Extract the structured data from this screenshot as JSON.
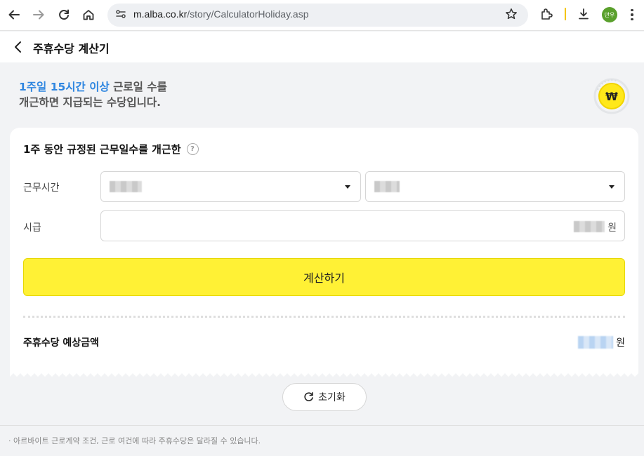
{
  "browser": {
    "url_host": "m.alba.co.kr",
    "url_path": "/story/CalculatorHoliday.asp",
    "profile_label": "만우",
    "icons": [
      "back-arrow-icon",
      "forward-arrow-icon",
      "reload-icon",
      "home-icon",
      "site-info-icon",
      "star-icon",
      "extensions-icon",
      "download-icon",
      "more-vert-icon"
    ]
  },
  "header": {
    "title": "주휴수당 계산기"
  },
  "intro": {
    "line1_highlight": "1주일 15시간 이상",
    "line1_rest": " 근로일 수를",
    "line2": "개근하면 지급되는 수당입니다."
  },
  "form": {
    "section_title": "1주 동안 규정된 근무일수를 개근한",
    "help_glyph": "?",
    "work_hours_label": "근무시간",
    "wage_label": "시급",
    "wage_unit": "원",
    "calc_button": "계산하기"
  },
  "result": {
    "label": "주휴수당 예상금액",
    "unit": "원"
  },
  "reset_button": "초기화",
  "footnote": "· 아르바이트 근로계약 조건, 근로 여건에 따라 주휴수당은 달라질 수 있습니다.",
  "colors": {
    "accent_blue": "#2f86e0",
    "button_yellow": "#fff135",
    "coin_yellow": "#ffe81a"
  }
}
